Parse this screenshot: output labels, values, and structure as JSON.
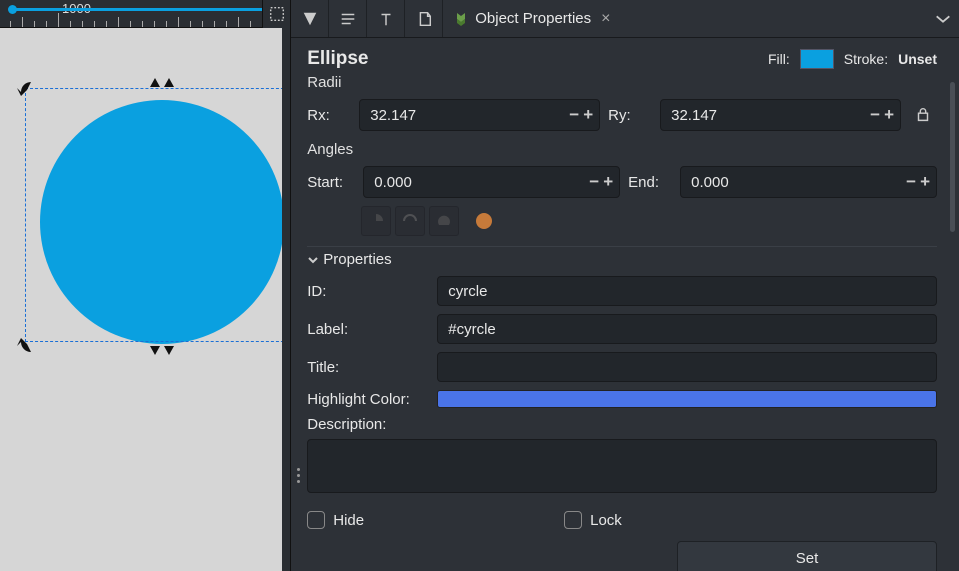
{
  "ruler": {
    "label": "1000"
  },
  "tabs": {
    "active_label": "Object Properties"
  },
  "header": {
    "title": "Ellipse",
    "fill_label": "Fill:",
    "fill_color": "#0aa0e0",
    "stroke_label": "Stroke:",
    "stroke_value": "Unset"
  },
  "radii": {
    "section": "Radii",
    "rx_label": "Rx:",
    "rx_value": "32.147",
    "ry_label": "Ry:",
    "ry_value": "32.147"
  },
  "angles": {
    "section": "Angles",
    "start_label": "Start:",
    "start_value": "0.000",
    "end_label": "End:",
    "end_value": "0.000"
  },
  "properties": {
    "section": "Properties",
    "id_label": "ID:",
    "id_value": "cyrcle",
    "label_label": "Label:",
    "label_value": "#cyrcle",
    "title_label": "Title:",
    "title_value": "",
    "highlight_label": "Highlight Color:",
    "highlight_color": "#4a74e8",
    "description_label": "Description:",
    "description_value": "",
    "hide_label": "Hide",
    "lock_label": "Lock",
    "set_label": "Set"
  }
}
